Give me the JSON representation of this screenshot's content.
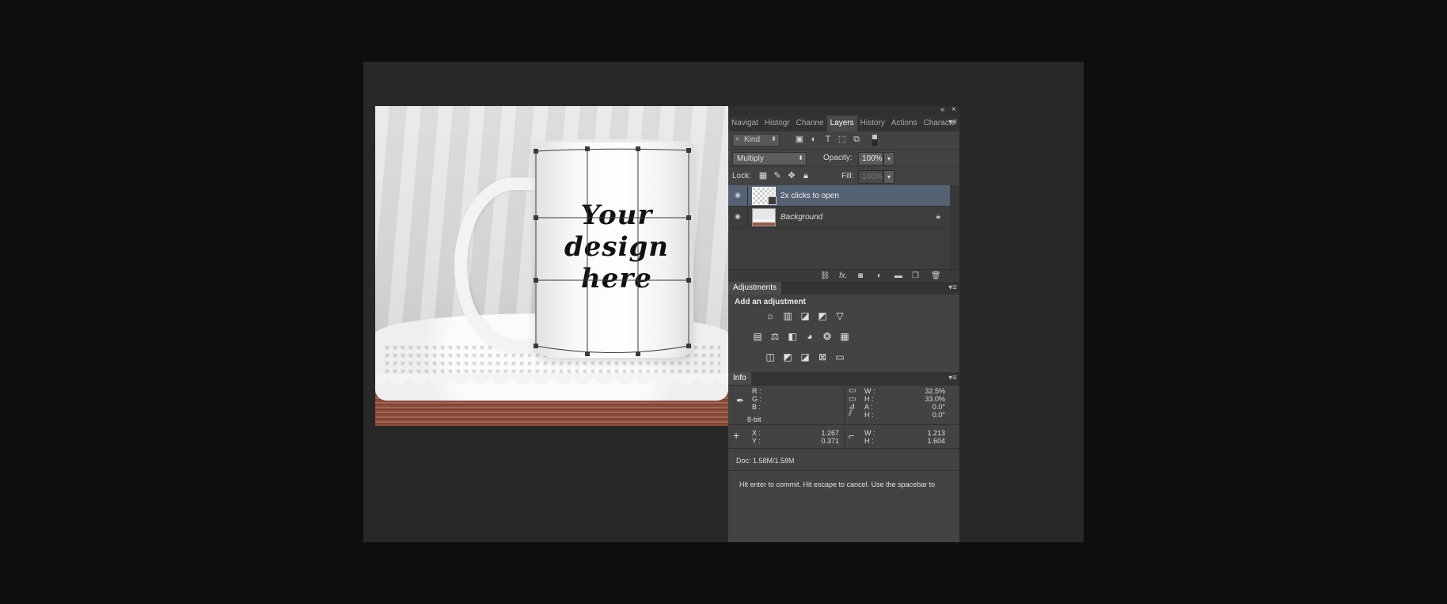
{
  "canvas": {
    "design_text_lines": [
      "Your",
      "design",
      "here"
    ]
  },
  "panel_tabs": [
    {
      "label": "Navigat",
      "active": false
    },
    {
      "label": "Histogr",
      "active": false
    },
    {
      "label": "Channe",
      "active": false
    },
    {
      "label": "Layers",
      "active": true
    },
    {
      "label": "History",
      "active": false
    },
    {
      "label": "Actions",
      "active": false
    },
    {
      "label": "Characte",
      "active": false
    }
  ],
  "layers_panel": {
    "kind_label": "Kind",
    "blend_mode": "Multiply",
    "opacity_label": "Opacity:",
    "opacity_value": "100%",
    "lock_label": "Lock:",
    "fill_label": "Fill:",
    "fill_value": "100%",
    "layers": [
      {
        "name": "2x clicks to open",
        "selected": true,
        "smart_object": true
      },
      {
        "name": "Background",
        "selected": false,
        "locked": true
      }
    ]
  },
  "adjustments_panel": {
    "tab": "Adjustments",
    "heading": "Add an adjustment"
  },
  "info_panel": {
    "tab": "Info",
    "rgb_labels": [
      "R :",
      "G :",
      "B :"
    ],
    "bit_depth": "8-bit",
    "transform": [
      {
        "label": "W :",
        "value": "32.5%"
      },
      {
        "label": "H :",
        "value": "33.0%"
      },
      {
        "label": "A :",
        "value": "0.0°"
      },
      {
        "label": "H :",
        "value": "0.0°"
      }
    ],
    "xy": [
      {
        "label": "X :",
        "value": "1.267"
      },
      {
        "label": "Y :",
        "value": "0.371"
      }
    ],
    "size": [
      {
        "label": "W :",
        "value": "1.213"
      },
      {
        "label": "H :",
        "value": "1.604"
      }
    ],
    "doc": "Doc: 1.58M/1.58M",
    "status": "Hit enter to commit. Hit escape to cancel. Use the spacebar to"
  },
  "colors": {
    "selected_layer": "#556274",
    "panel_bg": "#434343",
    "workspace_bg": "#282828"
  }
}
